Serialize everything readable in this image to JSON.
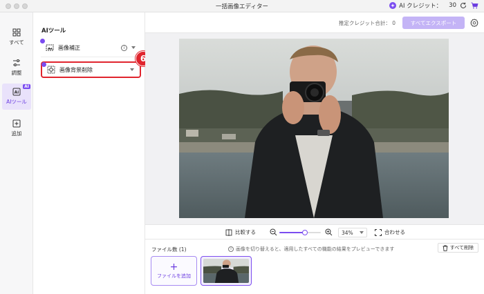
{
  "app": {
    "title": "一括画像エディター",
    "credits_label": "AI クレジット：",
    "credits_value": "30",
    "ai_badge": "AI"
  },
  "nav": {
    "items": [
      {
        "label": "すべて",
        "icon": "grid-icon"
      },
      {
        "label": "調整",
        "icon": "sliders-icon"
      },
      {
        "label": "AIツール",
        "icon": "ai-tools-icon",
        "badge": "AI",
        "active": true
      },
      {
        "label": "追加",
        "icon": "add-square-icon"
      }
    ]
  },
  "panel": {
    "title": "AIツール",
    "tools": [
      {
        "label": "画像補正",
        "icon": "enhance-icon",
        "info": "i"
      },
      {
        "label": "画像背景削除",
        "icon": "background-remove-icon"
      }
    ],
    "step_badge": "6"
  },
  "topbar": {
    "estimate": "推定クレジット合計： 0",
    "export_label": "すべてエクスポート"
  },
  "zoombar": {
    "compare_label": "比較する",
    "zoom_value": "34%",
    "zoom_percent": 34,
    "fit_label": "合わせる"
  },
  "files": {
    "count_label": "ファイル数 (1)",
    "hint": "画像を切り替えると、適用したすべての機能の結果をプレビューできます",
    "hint_icon": "i",
    "delete_all": "すべて削除",
    "add_label": "ファイルを追加",
    "add_plus": "+"
  },
  "colors": {
    "accent": "#7b4cf0",
    "highlight": "#e0242d",
    "export_disabled": "#c4b4f6"
  }
}
